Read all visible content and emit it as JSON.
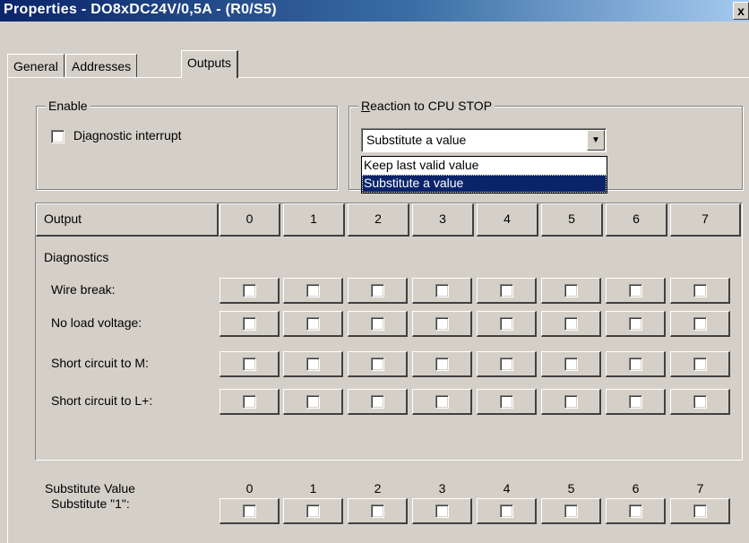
{
  "window": {
    "title": "Properties - DO8xDC24V/0,5A - (R0/S5)",
    "close_label": "x"
  },
  "tabs": [
    {
      "label": "General",
      "active": false
    },
    {
      "label": "Addresses",
      "active": false
    },
    {
      "label": "Outputs",
      "active": true
    }
  ],
  "enable": {
    "legend": "Enable",
    "diagnostic_label_pre": "D",
    "diagnostic_label_u": "i",
    "diagnostic_label_post": "agnostic interrupt",
    "diagnostic_checked": false
  },
  "reaction": {
    "legend_u": "R",
    "legend_rest": "eaction to CPU STOP",
    "selected": "Substitute a value",
    "options": [
      "Keep last valid value",
      "Substitute a value"
    ],
    "highlighted": "Substitute a value"
  },
  "table": {
    "header_label": "Output",
    "columns": [
      "0",
      "1",
      "2",
      "3",
      "4",
      "5",
      "6",
      "7"
    ],
    "section_label": "Diagnostics",
    "rows": [
      {
        "label": "Wire break:",
        "values": [
          false,
          false,
          false,
          false,
          false,
          false,
          false,
          false
        ]
      },
      {
        "label": "No load voltage:",
        "values": [
          false,
          false,
          false,
          false,
          false,
          false,
          false,
          false
        ]
      },
      {
        "label": "Short circuit to M:",
        "values": [
          false,
          false,
          false,
          false,
          false,
          false,
          false,
          false
        ]
      },
      {
        "label": "Short circuit to L+:",
        "values": [
          false,
          false,
          false,
          false,
          false,
          false,
          false,
          false
        ]
      }
    ]
  },
  "substitute": {
    "label": "Substitute Value",
    "columns": [
      "0",
      "1",
      "2",
      "3",
      "4",
      "5",
      "6",
      "7"
    ],
    "row_label": "Substitute \"1\":",
    "values": [
      false,
      false,
      false,
      false,
      false,
      false,
      false,
      false
    ]
  },
  "colors": {
    "title_bar": "#0a246a",
    "face": "#d4d0c8",
    "highlight": "#0a246a"
  },
  "icons": {
    "dropdown_arrow": "chevron-down-icon",
    "close": "close-icon"
  }
}
